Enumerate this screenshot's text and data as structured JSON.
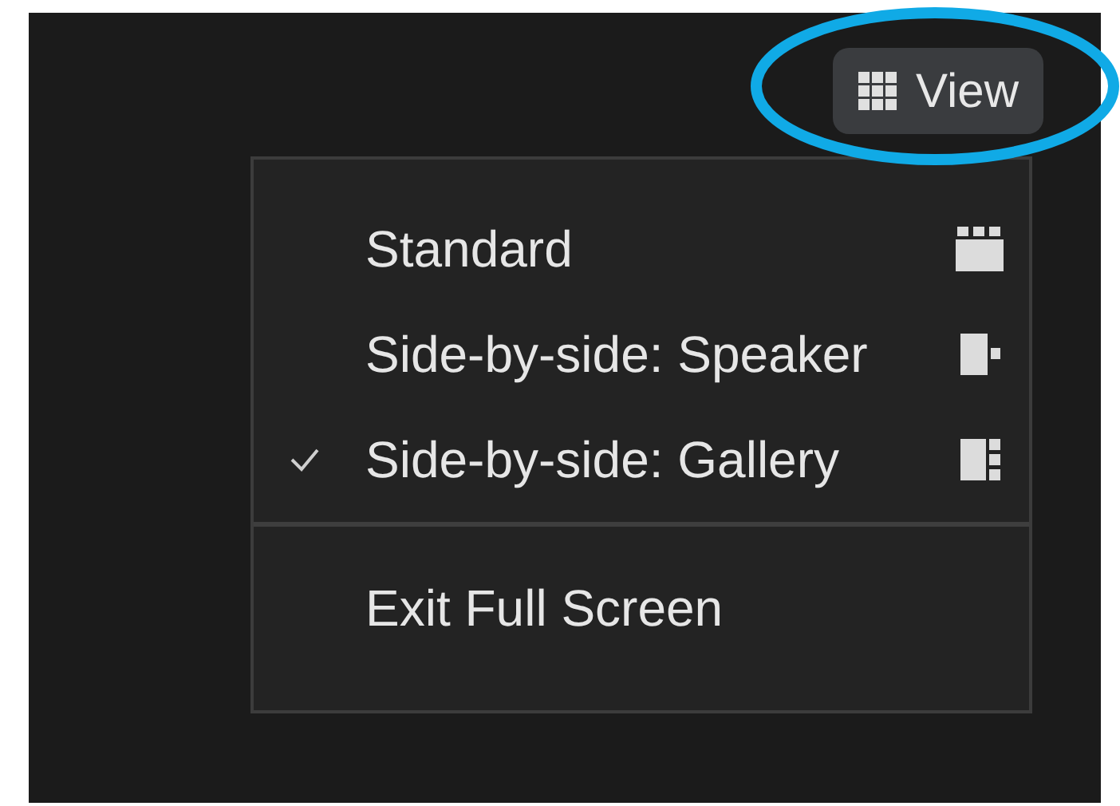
{
  "view_button": {
    "label": "View"
  },
  "menu": {
    "items": [
      {
        "kind": "layout",
        "label": "Standard",
        "checked": false
      },
      {
        "kind": "layout",
        "label": "Side-by-side: Speaker",
        "checked": false
      },
      {
        "kind": "layout",
        "label": "Side-by-side: Gallery",
        "checked": true
      },
      {
        "kind": "divider"
      },
      {
        "kind": "action",
        "label": "Exit Full Screen"
      }
    ]
  }
}
